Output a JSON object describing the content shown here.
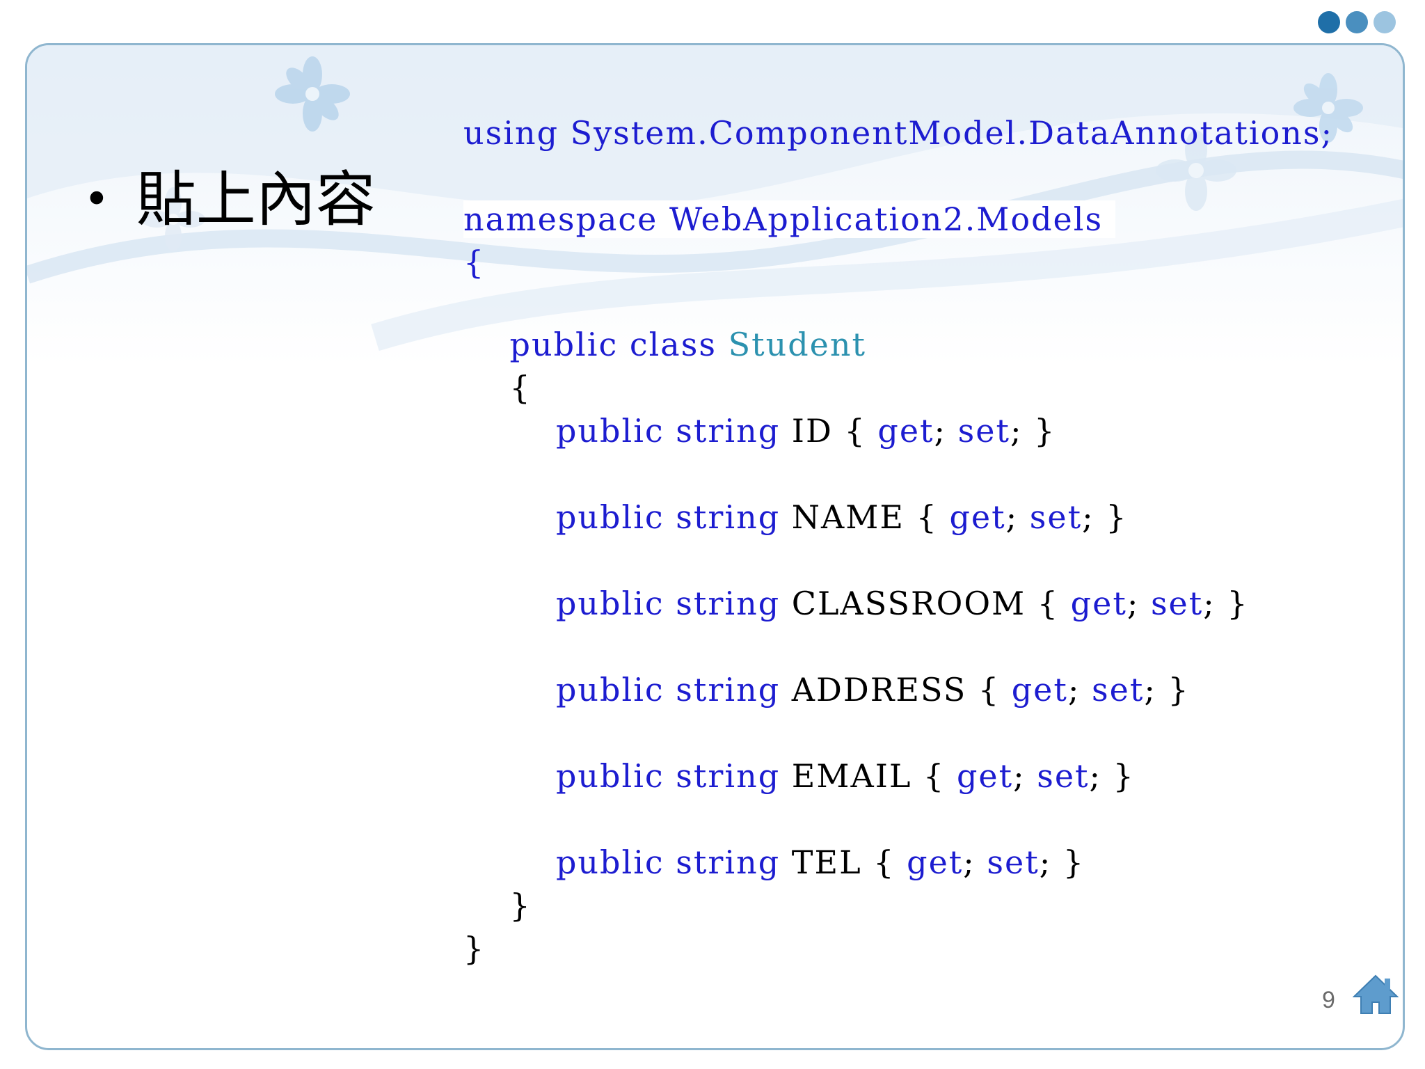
{
  "slide": {
    "bullet_text": "貼上內容",
    "page_number": "9"
  },
  "code": {
    "using_kw": "using",
    "using_rest": " System.ComponentModel.DataAnnotations;",
    "namespace_kw": "namespace",
    "namespace_rest": " WebApplication2.Models",
    "open_brace": "{",
    "class_kw": "public class",
    "class_name": "Student",
    "class_open": "{",
    "properties": [
      {
        "modifiers": "public string",
        "name": " ID { ",
        "get": "get",
        "sep": "; ",
        "set": "set",
        "end": "; }"
      },
      {
        "modifiers": "public string",
        "name": " NAME { ",
        "get": "get",
        "sep": "; ",
        "set": "set",
        "end": "; }"
      },
      {
        "modifiers": "public string",
        "name": " CLASSROOM { ",
        "get": "get",
        "sep": "; ",
        "set": "set",
        "end": "; }"
      },
      {
        "modifiers": "public string",
        "name": " ADDRESS { ",
        "get": "get",
        "sep": "; ",
        "set": "set",
        "end": "; }"
      },
      {
        "modifiers": "public string",
        "name": " EMAIL { ",
        "get": "get",
        "sep": "; ",
        "set": "set",
        "end": "; }"
      },
      {
        "modifiers": "public string",
        "name": " TEL { ",
        "get": "get",
        "sep": "; ",
        "set": "set",
        "end": "; }"
      }
    ],
    "class_close": "}",
    "close_brace": "}"
  },
  "colors": {
    "keyword": "#1c1cd0",
    "type": "#2b91af",
    "frame_border": "#8fb6cf",
    "dots": [
      "#1f6fa8",
      "#4a8fbf",
      "#9cc4e0"
    ]
  },
  "icons": [
    "dots-decoration-icon",
    "flower-icon",
    "home-icon"
  ]
}
